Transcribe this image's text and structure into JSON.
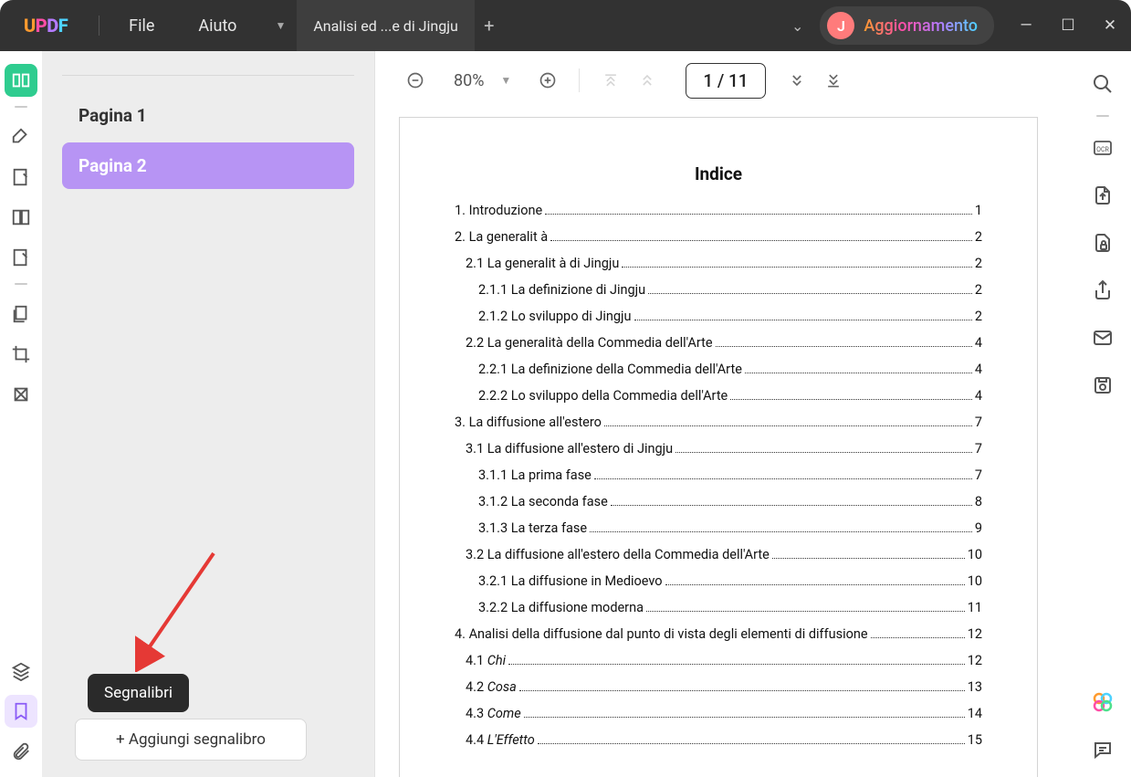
{
  "titlebar": {
    "file_menu": "File",
    "help_menu": "Aiuto",
    "tab_title": "Analisi ed ...e di Jingju",
    "update_initial": "J",
    "update_label": "Aggiornamento"
  },
  "bookmarks": {
    "items": [
      {
        "label": "Pagina 1"
      },
      {
        "label": "Pagina 2"
      }
    ],
    "add_label": "+ Aggiungi segnalibro",
    "tooltip": "Segnalibri"
  },
  "toolbar": {
    "zoom": "80%",
    "page_display": "1 / 11"
  },
  "toc": {
    "title": "Indice",
    "lines": [
      {
        "lvl": 0,
        "text": "1. Introduzione",
        "pg": "1"
      },
      {
        "lvl": 0,
        "text": "2. La generalit à",
        "pg": "2"
      },
      {
        "lvl": 1,
        "text": "2.1 La generalit à di Jingju",
        "pg": "2"
      },
      {
        "lvl": 2,
        "text": "2.1.1 La definizione di Jingju",
        "pg": "2"
      },
      {
        "lvl": 2,
        "text": "2.1.2 Lo sviluppo di Jingju",
        "pg": "2"
      },
      {
        "lvl": 1,
        "text": "2.2 La generalità della Commedia dell'Arte",
        "pg": "4"
      },
      {
        "lvl": 2,
        "text": "2.2.1 La definizione della Commedia dell'Arte",
        "pg": "4"
      },
      {
        "lvl": 2,
        "text": "2.2.2 Lo sviluppo della Commedia dell'Arte",
        "pg": "4"
      },
      {
        "lvl": 0,
        "text": "3. La diffusione all'estero",
        "pg": "7"
      },
      {
        "lvl": 1,
        "text": "3.1 La diffusione all'estero di Jingju",
        "pg": "7"
      },
      {
        "lvl": 2,
        "text": "3.1.1 La prima fase",
        "pg": "7"
      },
      {
        "lvl": 2,
        "text": "3.1.2 La seconda fase",
        "pg": "8"
      },
      {
        "lvl": 2,
        "text": "3.1.3 La terza fase",
        "pg": "9"
      },
      {
        "lvl": 1,
        "text": "3.2 La diffusione all'estero della Commedia dell'Arte",
        "pg": "10"
      },
      {
        "lvl": 2,
        "text": "3.2.1 La diffusione in Medioevo",
        "pg": "10"
      },
      {
        "lvl": 2,
        "text": "3.2.2 La diffusione moderna",
        "pg": "11"
      },
      {
        "lvl": 0,
        "text": "4. Analisi della diffusione dal punto di vista degli elementi di diffusione",
        "pg": "12"
      },
      {
        "lvl": 1,
        "text": "4.1 Chi",
        "italic": true,
        "pg": "12"
      },
      {
        "lvl": 1,
        "text": "4.2 Cosa",
        "italic": true,
        "pg": "13"
      },
      {
        "lvl": 1,
        "text": "4.3 Come",
        "italic": true,
        "pg": "14"
      },
      {
        "lvl": 1,
        "text": "4.4 L'Effetto",
        "italic": true,
        "pg": "15"
      }
    ]
  }
}
